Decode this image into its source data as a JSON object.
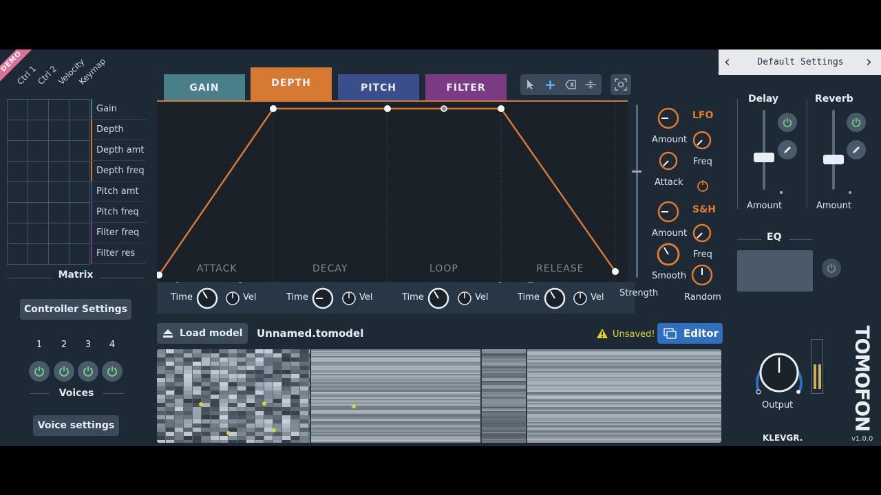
{
  "demo_badge": "DEMO",
  "matrix": {
    "columns": [
      "Ctrl 1",
      "Ctrl 2",
      "Velocity",
      "Keymap"
    ],
    "rows": [
      "Gain",
      "Depth",
      "Depth amt",
      "Depth freq",
      "Pitch amt",
      "Pitch freq",
      "Filter freq",
      "Filter res"
    ],
    "title": "Matrix"
  },
  "controller_settings_label": "Controller Settings",
  "voices": {
    "numbers": [
      "1",
      "2",
      "3",
      "4"
    ],
    "title": "Voices",
    "settings_label": "Voice settings"
  },
  "tabs": [
    {
      "label": "GAIN",
      "color": "#4a7e88"
    },
    {
      "label": "DEPTH",
      "color": "#d67933"
    },
    {
      "label": "PITCH",
      "color": "#3a4e8c"
    },
    {
      "label": "FILTER",
      "color": "#7a3a84"
    }
  ],
  "toolbar": {
    "icons": [
      "pointer-icon",
      "add-point-icon",
      "erase-icon",
      "split-icon",
      "snapshot-icon"
    ]
  },
  "envelope": {
    "stages": [
      "ATTACK",
      "DECAY",
      "LOOP",
      "RELEASE"
    ],
    "controls": [
      {
        "time": "Time",
        "vel": "Vel"
      },
      {
        "time": "Time",
        "vel": "Vel"
      },
      {
        "time": "Time",
        "vel": "Vel"
      },
      {
        "time": "Time",
        "vel": "Vel"
      }
    ]
  },
  "modulation": {
    "lfo_title": "LFO",
    "sh_title": "S&H",
    "lfo_amount": "Amount",
    "lfo_freq": "Freq",
    "attack": "Attack",
    "sh_amount": "Amount",
    "sh_freq": "Freq",
    "smooth": "Smooth",
    "random": "Random",
    "strength": "Strength"
  },
  "model": {
    "load_label": "Load model",
    "file_name": "Unnamed.tomodel",
    "status": "Unsaved!",
    "editor_label": "Editor"
  },
  "preset": {
    "name": "Default Settings"
  },
  "fx": {
    "delay": "Delay",
    "reverb": "Reverb",
    "delay_amount": "Amount",
    "reverb_amount": "Amount",
    "eq": "EQ",
    "output": "Output"
  },
  "brand": {
    "logo": "TOMOFON",
    "maker": "KLEVGR.",
    "version": "v1.0.0"
  },
  "colors": {
    "accent": "#d67933",
    "edit_blue": "#2f6fc0"
  }
}
